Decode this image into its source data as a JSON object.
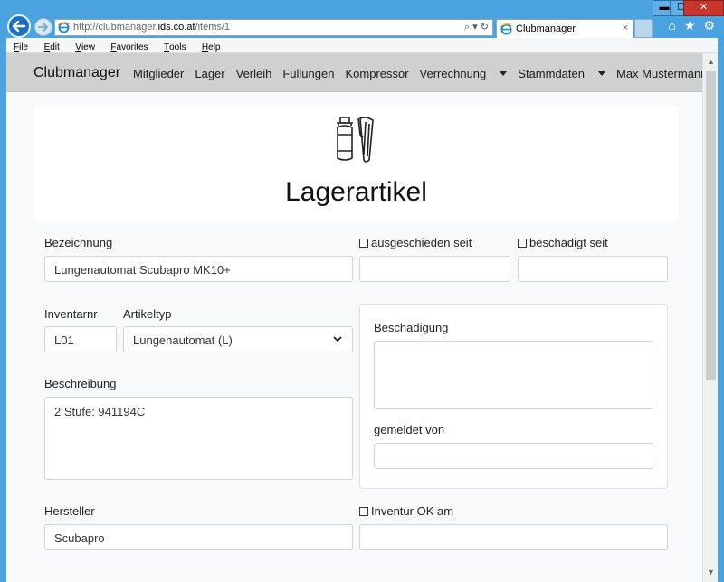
{
  "browser": {
    "url_host_prefix": "http://clubmanager.",
    "url_host": "ids.co.at",
    "url_path": "/items/1",
    "tab_title": "Clubmanager",
    "url_tools": "⌕ ▾ ↻",
    "tab_close": "×",
    "window_controls": {
      "minimize": "▬",
      "maximize": "☐",
      "close": "✕"
    },
    "icons": {
      "home": "⌂",
      "favorites": "★",
      "settings": "⚙"
    },
    "menu": [
      "File",
      "Edit",
      "View",
      "Favorites",
      "Tools",
      "Help"
    ],
    "menu_rest": [
      "ile",
      "dit",
      "iew",
      "avorites",
      "ools",
      "elp"
    ],
    "menu_first": [
      "F",
      "E",
      "V",
      "F",
      "T",
      "H"
    ]
  },
  "navbar": {
    "brand": "Clubmanager",
    "links": {
      "mitglieder": "Mitglieder",
      "lager": "Lager",
      "verleih": "Verleih",
      "fuellungen": "Füllungen",
      "kompressor": "Kompressor",
      "verrechnung": "Verrechnung",
      "stammdaten": "Stammdaten",
      "user": "Max Mustermann"
    }
  },
  "hero": {
    "title": "Lagerartikel"
  },
  "form": {
    "bezeichnung_label": "Bezeichnung",
    "bezeichnung_value": "Lungenautomat Scubapro MK10+",
    "ausgeschieden_label": "ausgeschieden seit",
    "ausgeschieden_value": "",
    "beschaedigt_label": "beschädigt seit",
    "beschaedigt_value": "",
    "inventarnr_label": "Inventarnr",
    "inventarnr_value": "L01",
    "artikeltyp_label": "Artikeltyp",
    "artikeltyp_value": "Lungenautomat (L)",
    "beschreibung_label": "Beschreibung",
    "beschreibung_value": "2 Stufe: 941194C",
    "beschaedigung_label": "Beschädigung",
    "beschaedigung_value": "",
    "gemeldet_label": "gemeldet von",
    "gemeldet_value": "",
    "hersteller_label": "Hersteller",
    "hersteller_value": "Scubapro",
    "inventur_label": "Inventur OK am",
    "inventur_value": ""
  },
  "colors": {
    "window_frame": "#4aa3df",
    "navbar_bg": "#cfd0d1",
    "page_bg": "#f8f9fa",
    "input_border": "#ced4da"
  }
}
